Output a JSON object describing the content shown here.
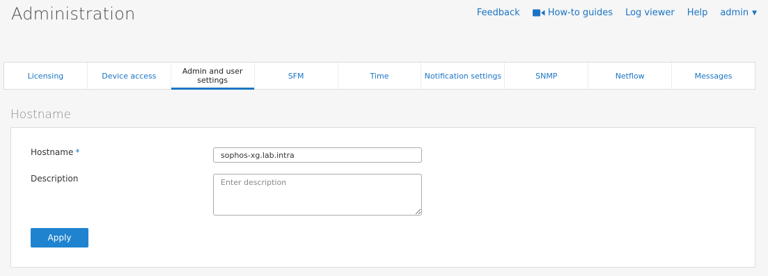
{
  "page": {
    "title": "Administration"
  },
  "top_nav": {
    "feedback": "Feedback",
    "howto": "How-to guides",
    "logviewer": "Log viewer",
    "help": "Help",
    "user": "admin"
  },
  "tabs": [
    {
      "label": "Licensing"
    },
    {
      "label": "Device access"
    },
    {
      "label": "Admin and user settings",
      "active": true
    },
    {
      "label": "SFM"
    },
    {
      "label": "Time"
    },
    {
      "label": "Notification settings"
    },
    {
      "label": "SNMP"
    },
    {
      "label": "Netflow"
    },
    {
      "label": "Messages"
    }
  ],
  "section": {
    "title": "Hostname",
    "hostname_label": "Hostname",
    "required_mark": "*",
    "hostname_value": "sophos-xg.lab.intra",
    "description_label": "Description",
    "description_placeholder": "Enter description",
    "apply_label": "Apply"
  },
  "colors": {
    "accent": "#1a74c4",
    "button": "#1f83cf"
  }
}
